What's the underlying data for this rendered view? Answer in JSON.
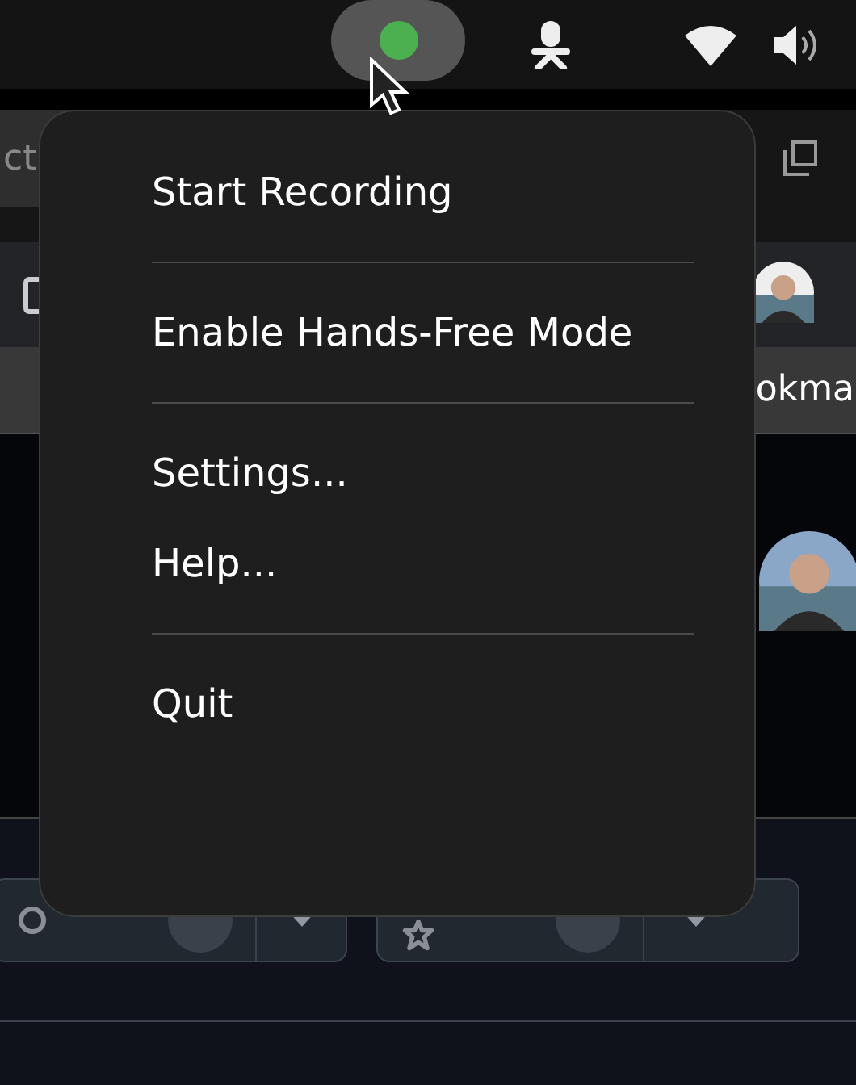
{
  "address_bar": {
    "text": "ct"
  },
  "bookmarks_bar": {
    "text": "okma"
  },
  "repo_actions": [
    {
      "kind": "fork"
    },
    {
      "kind": "star"
    }
  ],
  "menu": {
    "items": [
      {
        "kind": "item",
        "label": "Start Recording"
      },
      {
        "kind": "separator"
      },
      {
        "kind": "item",
        "label": "Enable Hands-Free Mode"
      },
      {
        "kind": "separator"
      },
      {
        "kind": "item",
        "label": "Settings..."
      },
      {
        "kind": "item",
        "label": "Help..."
      },
      {
        "kind": "separator"
      },
      {
        "kind": "item",
        "label": "Quit"
      }
    ]
  }
}
